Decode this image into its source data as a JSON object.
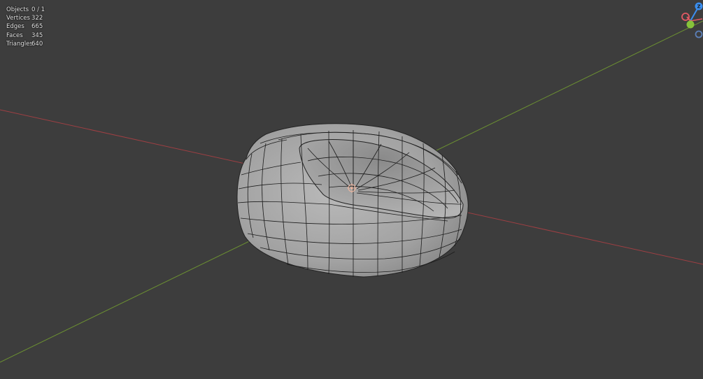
{
  "stats": [
    {
      "label": "Objects",
      "value": "0 / 1"
    },
    {
      "label": "Vertices",
      "value": "322"
    },
    {
      "label": "Edges",
      "value": "665"
    },
    {
      "label": "Faces",
      "value": "345"
    },
    {
      "label": "Triangles",
      "value": "640"
    }
  ],
  "gizmo": {
    "z_label": "Z",
    "x_color": "#e25a64",
    "y_color": "#86c23a",
    "z_color": "#3b8ff0",
    "neg_color": "#5b7fb8"
  },
  "axes": {
    "x_color": "#9e3f43",
    "y_color": "#6c9132"
  },
  "mesh": {
    "fill": "#a7a7a7",
    "wire": "#1c1c1c"
  }
}
